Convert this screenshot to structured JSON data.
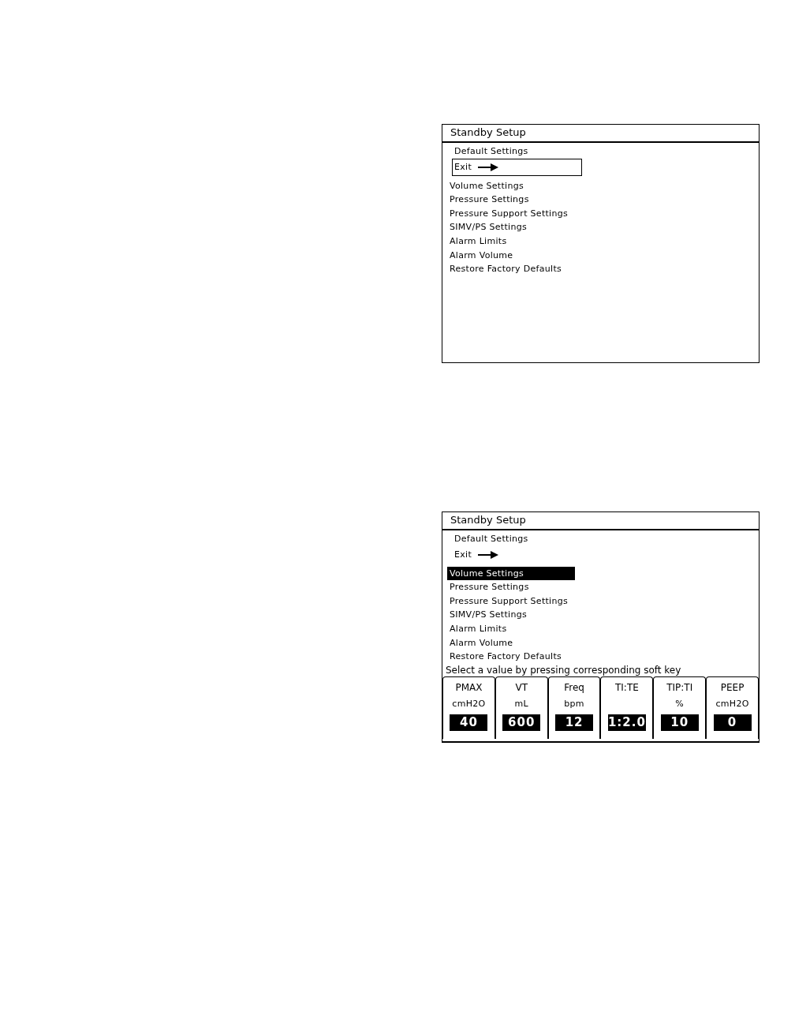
{
  "screens": [
    {
      "title": "Standby Setup",
      "heading": "Default Settings",
      "exit": {
        "label": "Exit",
        "focused": true
      },
      "items": [
        {
          "label": "Volume Settings",
          "selected": false
        },
        {
          "label": "Pressure Settings",
          "selected": false
        },
        {
          "label": "Pressure Support Settings",
          "selected": false
        },
        {
          "label": "SIMV/PS Settings",
          "selected": false
        },
        {
          "label": "Alarm Limits",
          "selected": false
        },
        {
          "label": "Alarm Volume",
          "selected": false
        },
        {
          "label": "Restore Factory Defaults",
          "selected": false
        }
      ]
    },
    {
      "title": "Standby Setup",
      "heading": "Default Settings",
      "exit": {
        "label": "Exit",
        "focused": false
      },
      "items": [
        {
          "label": "Volume Settings",
          "selected": true
        },
        {
          "label": "Pressure Settings",
          "selected": false
        },
        {
          "label": "Pressure Support Settings",
          "selected": false
        },
        {
          "label": "SIMV/PS Settings",
          "selected": false
        },
        {
          "label": "Alarm Limits",
          "selected": false
        },
        {
          "label": "Alarm Volume",
          "selected": false
        },
        {
          "label": "Restore Factory Defaults",
          "selected": false
        }
      ],
      "prompt": "Select a value by pressing corresponding soft key",
      "soft_keys": [
        {
          "label": "PMAX",
          "unit": "cmH2O",
          "value": "40"
        },
        {
          "label": "VT",
          "unit": "mL",
          "value": "600"
        },
        {
          "label": "Freq",
          "unit": "bpm",
          "value": "12"
        },
        {
          "label": "TI:TE",
          "value": "1:2.0"
        },
        {
          "label": "TIP:TI",
          "unit": "%",
          "value": "10"
        },
        {
          "label": "PEEP",
          "unit": "cmH2O",
          "value": "0"
        }
      ]
    }
  ]
}
